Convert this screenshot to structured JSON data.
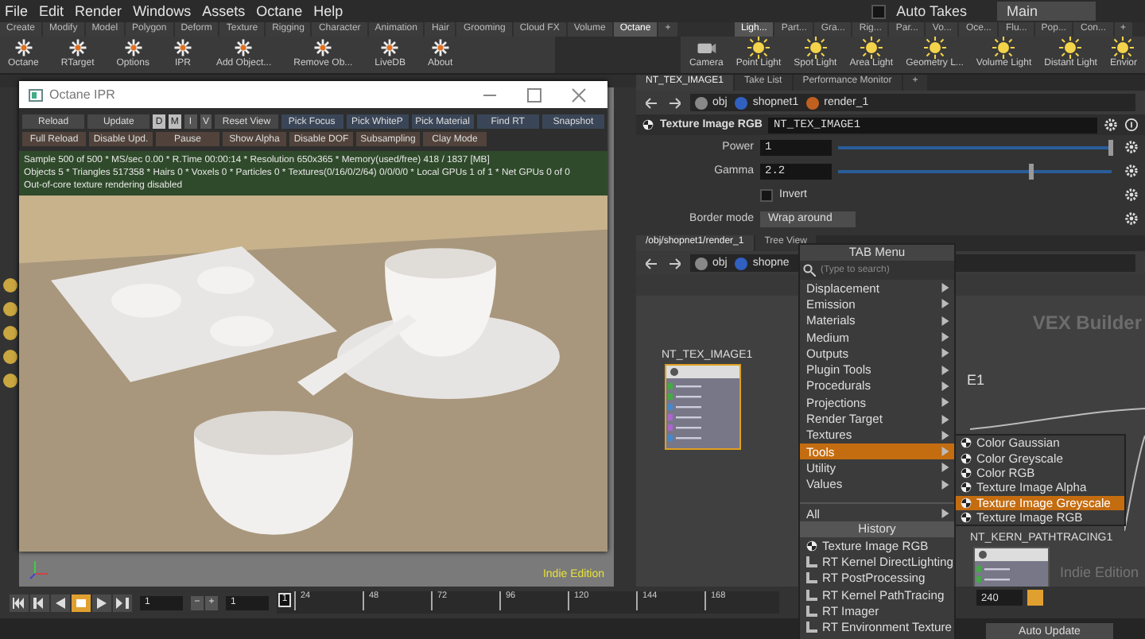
{
  "menu_bar": {
    "items": [
      "File",
      "Edit",
      "Render",
      "Windows",
      "Assets",
      "Octane",
      "Help"
    ],
    "auto_takes": {
      "label": "Auto Takes",
      "checked": false
    },
    "desktop": "Main"
  },
  "shelf_left": {
    "tabs": [
      {
        "label": "Create",
        "selected": false
      },
      {
        "label": "Modify",
        "selected": false
      },
      {
        "label": "Model",
        "selected": false
      },
      {
        "label": "Polygon",
        "selected": false
      },
      {
        "label": "Deform",
        "selected": false
      },
      {
        "label": "Texture",
        "selected": false
      },
      {
        "label": "Rigging",
        "selected": false
      },
      {
        "label": "Character",
        "selected": false
      },
      {
        "label": "Animation",
        "selected": false
      },
      {
        "label": "Hair",
        "selected": false
      },
      {
        "label": "Grooming",
        "selected": false
      },
      {
        "label": "Cloud FX",
        "selected": false
      },
      {
        "label": "Volume",
        "selected": false
      },
      {
        "label": "Octane",
        "selected": true
      }
    ],
    "add": "+",
    "tools": [
      "Octane",
      "RTarget",
      "Options",
      "IPR",
      "Add Object...",
      "Remove Ob...",
      "LiveDB",
      "About"
    ]
  },
  "shelf_right": {
    "tabs": [
      {
        "label": "Ligh...",
        "selected": true
      },
      {
        "label": "Part...",
        "selected": false
      },
      {
        "label": "Gra...",
        "selected": false
      },
      {
        "label": "Rig...",
        "selected": false
      },
      {
        "label": "Par...",
        "selected": false
      },
      {
        "label": "Vo...",
        "selected": false
      },
      {
        "label": "Oce...",
        "selected": false
      },
      {
        "label": "Flu...",
        "selected": false
      },
      {
        "label": "Pop...",
        "selected": false
      },
      {
        "label": "Con...",
        "selected": false
      }
    ],
    "add": "+",
    "tools": [
      "Camera",
      "Point Light",
      "Spot Light",
      "Area Light",
      "Geometry L...",
      "Volume Light",
      "Distant Light",
      "Envior"
    ]
  },
  "ipr_window": {
    "title": "Octane IPR",
    "row_1_start": [
      "Reload",
      "Update"
    ],
    "view_toggles": [
      {
        "label": "D",
        "on": true
      },
      {
        "label": "M",
        "on": true
      },
      {
        "label": "I",
        "on": false
      },
      {
        "label": "V",
        "on": false
      }
    ],
    "row_1_end": [
      {
        "label": "Reset View",
        "kind": "plain"
      },
      {
        "label": "Pick Focus",
        "kind": "pick"
      },
      {
        "label": "Pick WhiteP",
        "kind": "pick"
      },
      {
        "label": "Pick Material",
        "kind": "pick"
      },
      {
        "label": "Find RT",
        "kind": "pick"
      },
      {
        "label": "Snapshot",
        "kind": "pick"
      }
    ],
    "row_2": [
      "Full Reload",
      "Disable Upd.",
      "Pause",
      "Show Alpha",
      "Disable DOF",
      "Subsampling",
      "Clay Mode"
    ],
    "status_lines": [
      "Sample 500 of 500 * MS/sec 0.00 * R.Time 00:00:14 * Resolution 650x365 * Memory(used/free) 418 / 1837 [MB]",
      "Objects 5 * Triangles 517358 * Hairs 0 * Voxels 0 * Particles 0 * Textures(0/16/0/2/64) 0/0/0/0 * Local GPUs 1 of 1 * Net GPUs 0 of 0",
      "Out-of-core texture rendering disabled"
    ]
  },
  "viewport": {
    "edition": "Indie Edition"
  },
  "parameters_pane": {
    "tabs": [
      {
        "label": "NT_TEX_IMAGE1",
        "selected": true
      },
      {
        "label": "Take List",
        "selected": false
      },
      {
        "label": "Performance Monitor",
        "selected": false
      }
    ],
    "add": "+",
    "path": [
      "obj",
      "shopnet1",
      "render_1"
    ],
    "node_type": "Texture Image RGB",
    "node_name": "NT_TEX_IMAGE1",
    "params": [
      {
        "kind": "slider",
        "label": "Power",
        "value": "1",
        "level": 1.0
      },
      {
        "kind": "slider",
        "label": "Gamma",
        "value": "2.2",
        "level": 0.71
      },
      {
        "kind": "checkbox",
        "label": "Invert",
        "checked": false
      },
      {
        "kind": "menu",
        "label": "Border mode",
        "value": "Wrap around"
      }
    ]
  },
  "network_pane": {
    "tabs": [
      {
        "label": "/obj/shopnet1/render_1",
        "selected": true
      },
      {
        "label": "Tree View",
        "selected": false
      }
    ],
    "path": [
      "obj",
      "shopne"
    ],
    "context": "VEX Builder",
    "edition": "Indie Edition",
    "nodes": [
      {
        "name": "NT_TEX_IMAGE1",
        "selected": true
      },
      {
        "name": "NT_KERN_PATHTRACING1",
        "selected": false
      }
    ],
    "cut_label": "E1"
  },
  "tab_menu": {
    "title": "TAB Menu",
    "search": {
      "placeholder": "(Type to search)"
    },
    "items": [
      {
        "label": "Displacement",
        "selected": false
      },
      {
        "label": "Emission",
        "selected": false
      },
      {
        "label": "Materials",
        "selected": false
      },
      {
        "label": "Medium",
        "selected": false
      },
      {
        "label": "Outputs",
        "selected": false
      },
      {
        "label": "Plugin Tools",
        "selected": false
      },
      {
        "label": "Procedurals",
        "selected": false
      },
      {
        "label": "Projections",
        "selected": false
      },
      {
        "label": "Render Target",
        "selected": false
      },
      {
        "label": "Textures",
        "selected": false
      },
      {
        "label": "Tools",
        "selected": true
      },
      {
        "label": "Utility",
        "selected": false
      },
      {
        "label": "Values",
        "selected": false
      }
    ],
    "all": "All",
    "history_title": "History",
    "history": [
      "Texture Image RGB",
      "RT Kernel DirectLighting",
      "RT PostProcessing",
      "RT Kernel PathTracing",
      "RT Imager",
      "RT Environment Texture"
    ],
    "submenu": [
      {
        "label": "Color Gaussian",
        "selected": false
      },
      {
        "label": "Color Greyscale",
        "selected": false
      },
      {
        "label": "Color RGB",
        "selected": false
      },
      {
        "label": "Texture Image Alpha",
        "selected": false
      },
      {
        "label": "Texture Image Greyscale",
        "selected": true
      },
      {
        "label": "Texture Image RGB",
        "selected": false
      }
    ]
  },
  "timeline": {
    "transport": [
      {
        "selected": false
      },
      {
        "selected": false
      },
      {
        "selected": false
      },
      {
        "selected": true
      },
      {
        "selected": false
      },
      {
        "selected": false
      }
    ],
    "frame": "1",
    "step_buttons": [
      "−",
      "+"
    ],
    "start": "1",
    "current_marker": "1",
    "ticks": [
      "24",
      "48",
      "72",
      "96",
      "120",
      "144",
      "168"
    ],
    "end": "240",
    "auto_update": "Auto Update"
  }
}
